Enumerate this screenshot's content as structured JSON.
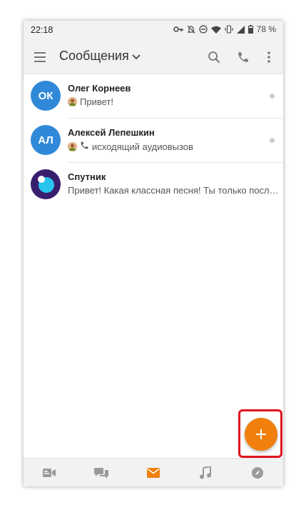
{
  "status_bar": {
    "time": "22:18",
    "battery": "78 %",
    "icons": [
      "key-icon",
      "bell-off-icon",
      "dnd-icon",
      "wifi-icon",
      "vibrate-icon",
      "signal-icon",
      "battery-icon"
    ]
  },
  "app_bar": {
    "title": "Сообщения",
    "icons": [
      "menu-icon",
      "chevron-down-icon",
      "search-icon",
      "phone-icon",
      "more-icon"
    ]
  },
  "chats": [
    {
      "initials": "ОК",
      "name": "Олег Корнеев",
      "preview": "Привет!",
      "avatar_color": "#2f89d8",
      "has_mini_avatar": true,
      "has_call_icon": false
    },
    {
      "initials": "АЛ",
      "name": "Алексей Лепешкин",
      "preview": "исходящий аудиовызов",
      "avatar_color": "#2f89d8",
      "has_mini_avatar": true,
      "has_call_icon": true
    },
    {
      "initials": "",
      "name": "Спутник",
      "preview": "Привет! Какая классная песня! Ты только посл…",
      "avatar_color": "#3a1e6e",
      "has_mini_avatar": false,
      "has_call_icon": false
    }
  ],
  "fab": {
    "label": "+",
    "color": "#f07f0c"
  },
  "bottom_nav": {
    "items": [
      "video-icon",
      "chats-icon",
      "mail-icon",
      "music-icon",
      "compass-icon"
    ],
    "active": "mail-icon",
    "active_color": "#f07f0c",
    "inactive_color": "#9a9a9a"
  },
  "colors": {
    "accent": "#f07f0c",
    "highlight": "#e0141e",
    "avatar_blue": "#2f89d8"
  }
}
